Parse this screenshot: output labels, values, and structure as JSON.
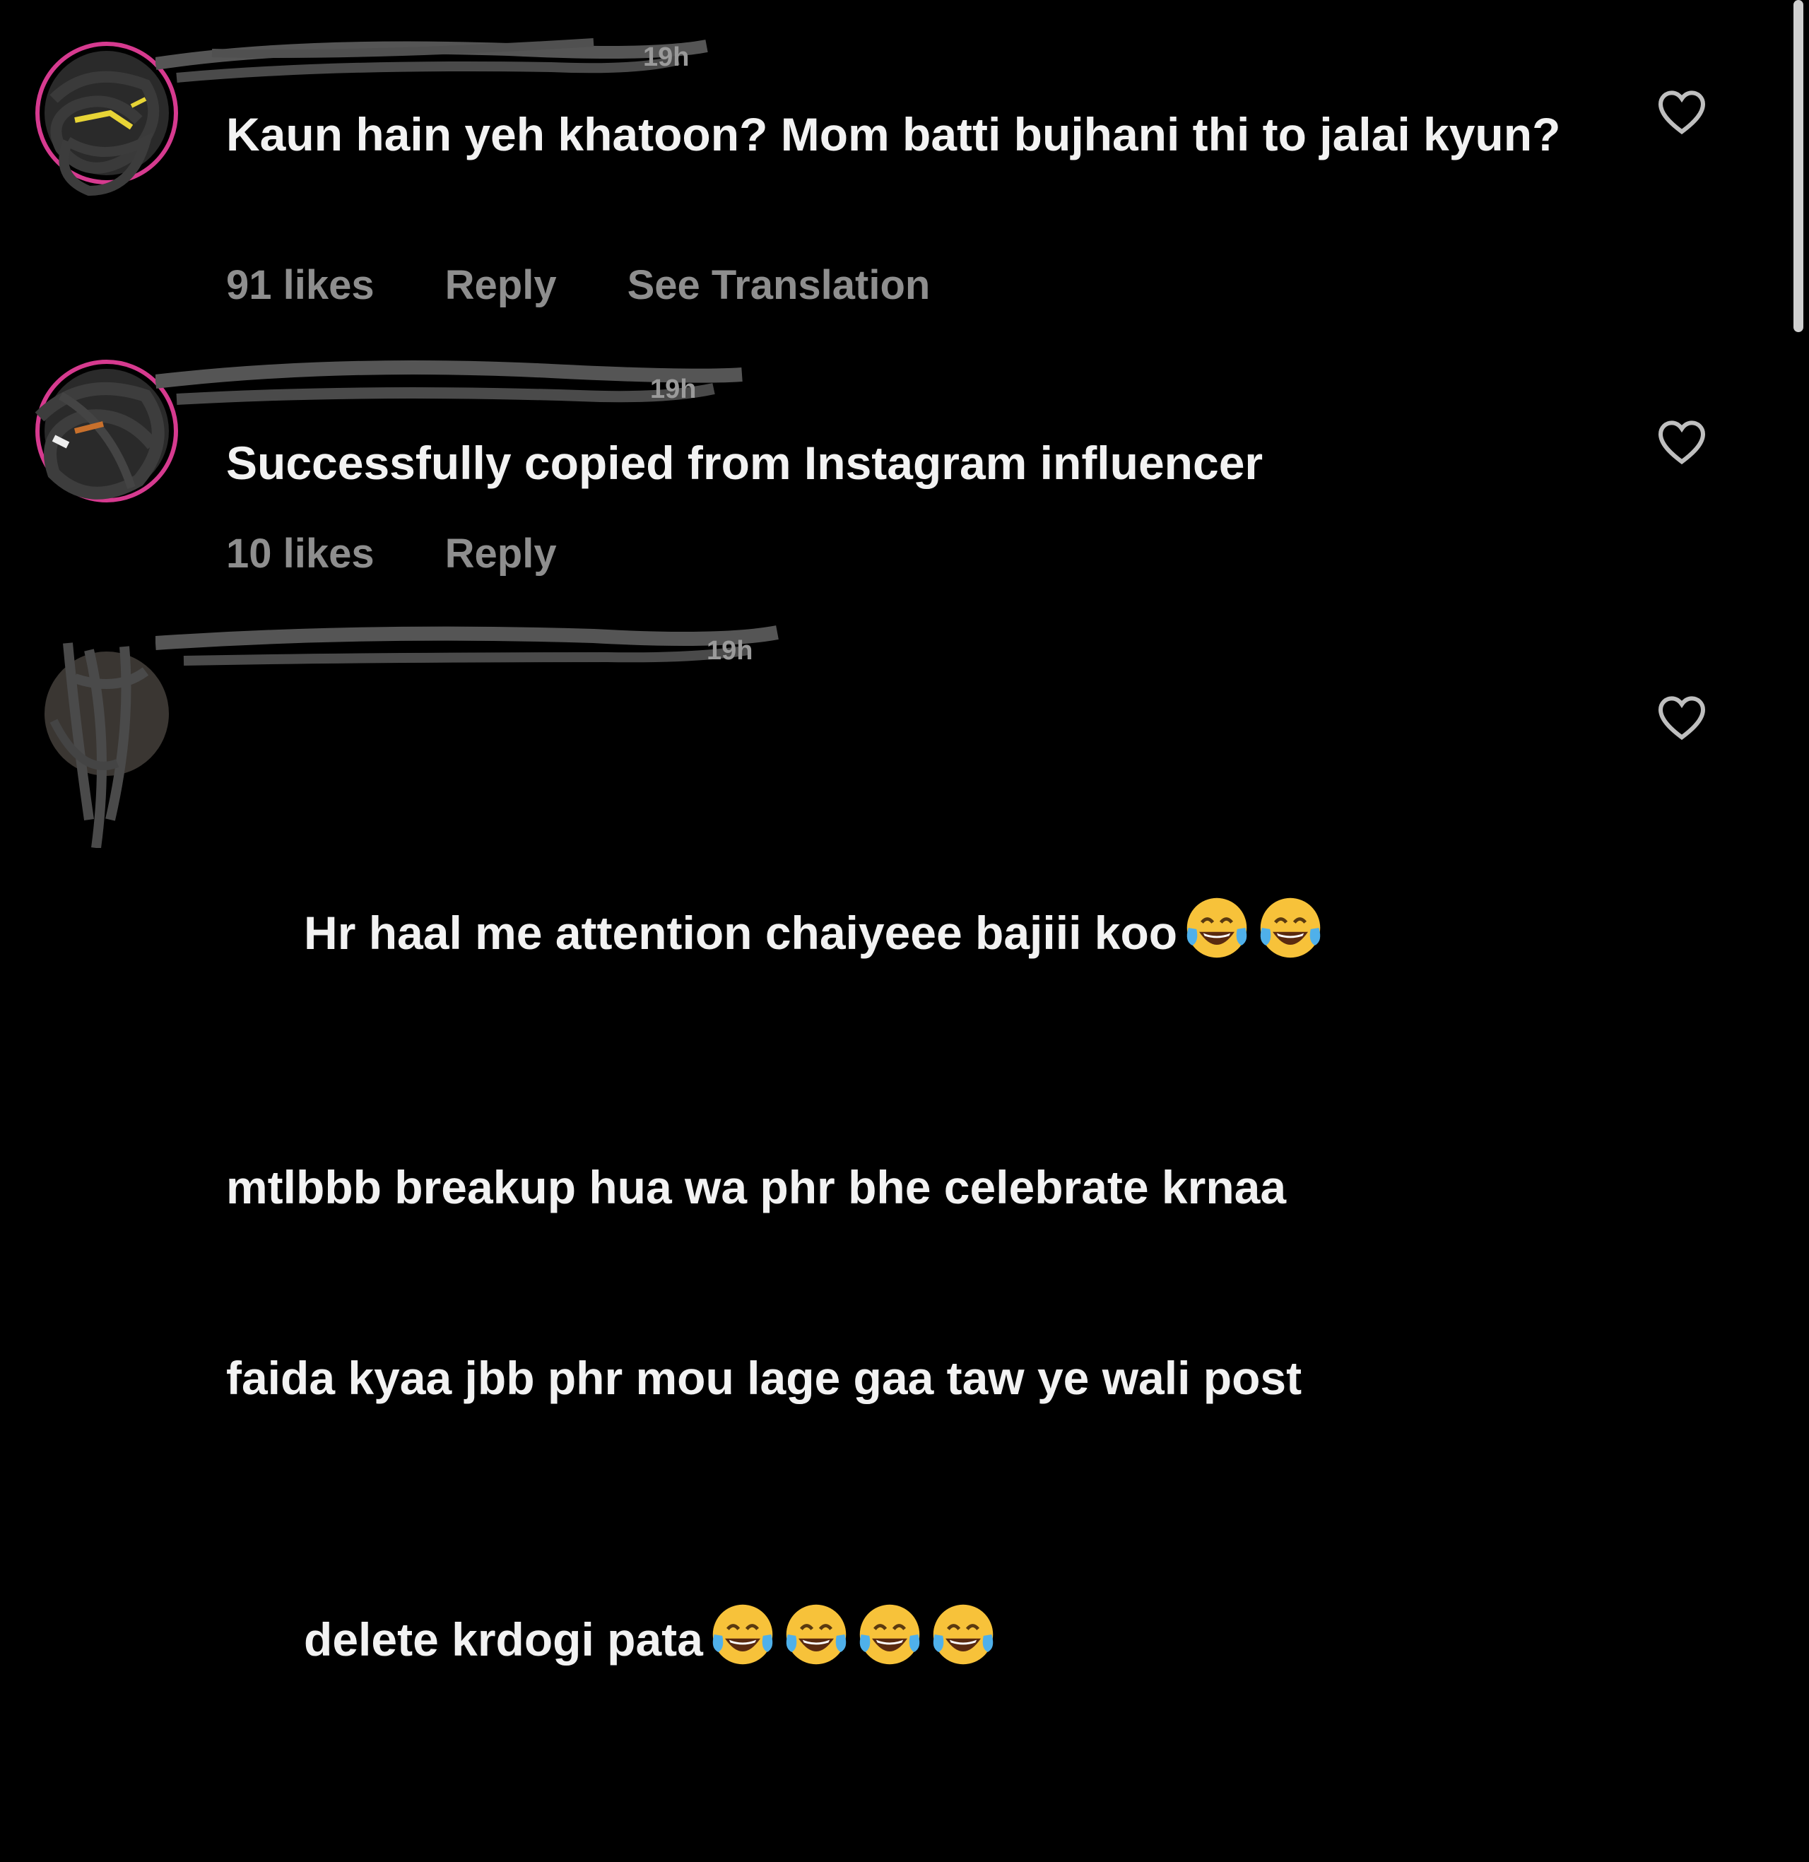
{
  "comments": [
    {
      "time": "19h",
      "text": "Kaun hain yeh khatoon? Mom batti bujhani thi to jalai kyun?",
      "likes": "91 likes",
      "reply": "Reply",
      "translate": "See Translation"
    },
    {
      "time": "19h",
      "text": "Successfully copied from Instagram influencer",
      "likes": "10 likes",
      "reply": "Reply"
    },
    {
      "time": "19h",
      "text_line1": "Hr haal me attention chaiyeee bajiii koo",
      "text_line2": "mtlbbb breakup hua wa phr bhe celebrate krnaa",
      "text_line3": "faida kyaa jbb phr mou lage gaa taw ye wali post",
      "text_line4": "delete krdogi pata"
    }
  ],
  "icons": {
    "like": "heart-outline-icon",
    "emoji": "face-with-tears-of-joy-icon"
  },
  "colors": {
    "background": "#000000",
    "text": "#f2f2f2",
    "meta": "#8e8e8e"
  }
}
